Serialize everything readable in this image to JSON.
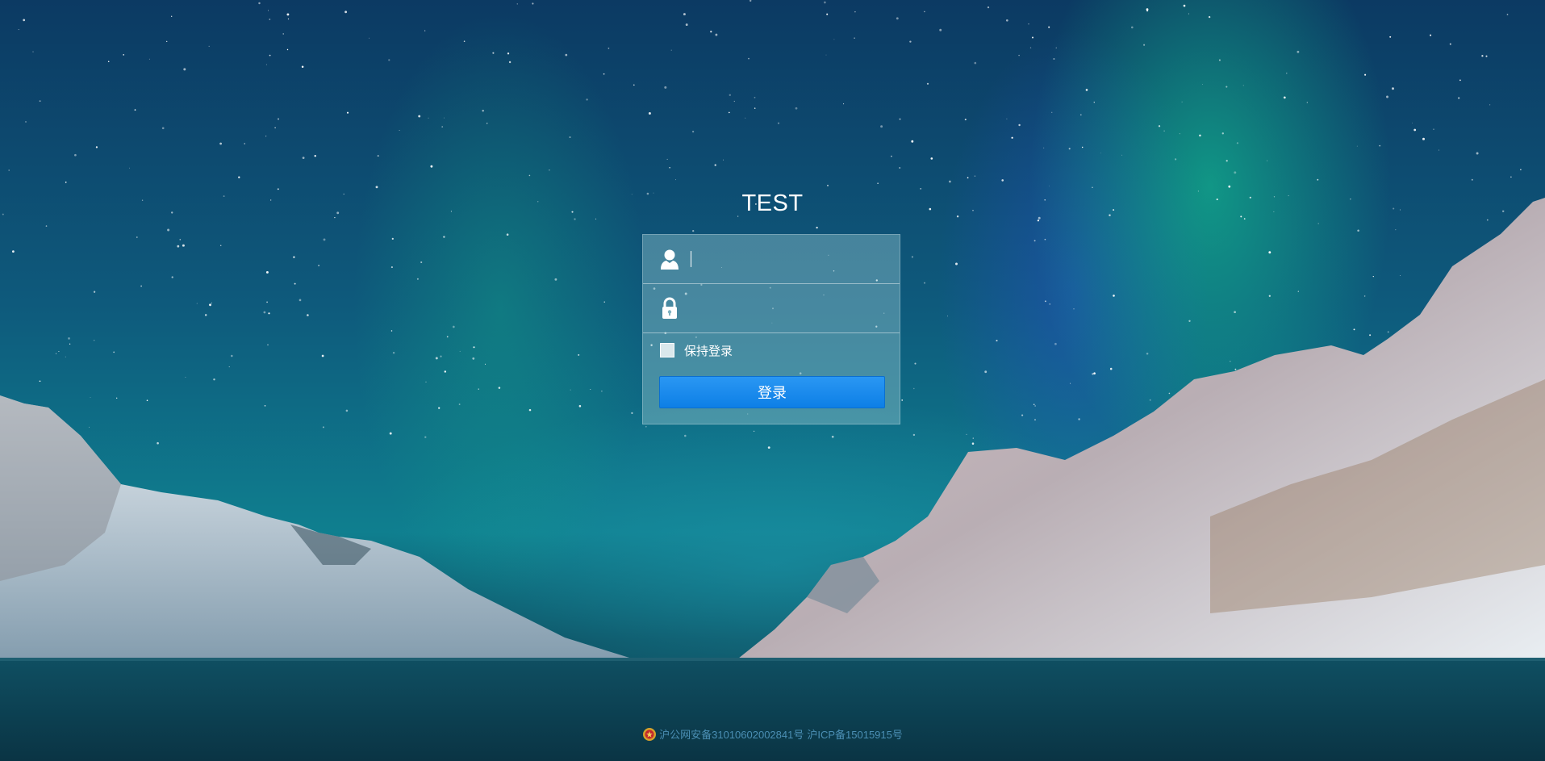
{
  "app": {
    "title": "TEST"
  },
  "login_form": {
    "username": {
      "value": "",
      "placeholder": "",
      "icon": "user-icon"
    },
    "password": {
      "value": "",
      "placeholder": "",
      "icon": "lock-icon"
    },
    "remember": {
      "label": "保持登录",
      "checked": false
    },
    "submit_label": "登录"
  },
  "footer": {
    "police_record": "沪公网安备31010602002841号",
    "icp_record": "沪ICP备15015915号",
    "emblem_icon": "police-emblem-icon"
  },
  "colors": {
    "button": "#0d7fe6",
    "footer_text": "#4b8fb4",
    "title_text": "#ffffff"
  }
}
